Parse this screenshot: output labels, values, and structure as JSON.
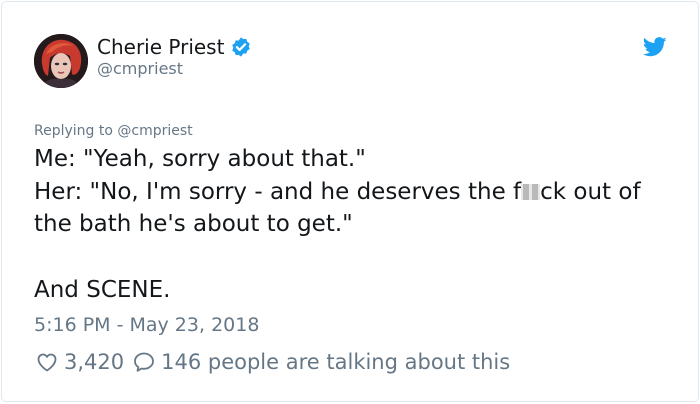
{
  "author": {
    "display_name": "Cherie Priest",
    "handle": "@cmpriest",
    "verified_icon": "verified-badge-icon",
    "avatar_icon": "avatar"
  },
  "brand": {
    "icon": "twitter-bird-icon",
    "color": "#1da1f2"
  },
  "tweet": {
    "replying_to": "Replying to @cmpriest",
    "line1": "Me: \"Yeah, sorry about that.\"",
    "line2_before": "Her: \"No, I'm sorry - and he deserves the f",
    "line2_after": "ck out of",
    "line3": "the bath he's about to get.\"",
    "line4": "And SCENE.",
    "timestamp": "5:16 PM - May 23, 2018"
  },
  "actions": {
    "like_icon": "heart-icon",
    "like_count": "3,420",
    "reply_icon": "speech-bubble-icon",
    "talking_text": "146 people are talking about this"
  },
  "colors": {
    "text": "#14171a",
    "secondary": "#657786",
    "border": "#e1e8ed",
    "verified": "#1da1f2"
  }
}
